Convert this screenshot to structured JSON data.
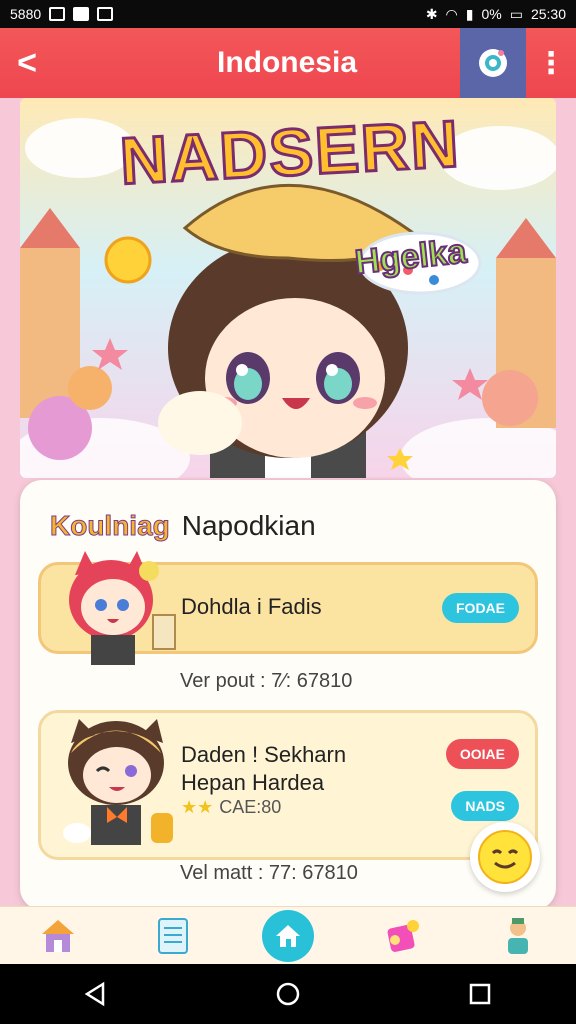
{
  "status_bar": {
    "left_text": "5880",
    "time": "25:30",
    "battery": "0%"
  },
  "app_bar": {
    "title": "Indonesia",
    "back_symbol": "<",
    "more_symbol": "⋮"
  },
  "banner": {
    "title": "NADSERN",
    "subtitle": "Hgelka"
  },
  "panel": {
    "tag": "Koulniag",
    "name": "Napodkian",
    "cards": [
      {
        "title": "Dohdla i Fadis",
        "badge": "FODAE",
        "meta": "Ver pout : 7⁄: 67810"
      },
      {
        "title_line1": "Daden ! Sekharn",
        "title_line2": "Hepan Hardea",
        "stars_text": "CAE:80",
        "badge_top": "OOIAE",
        "badge_bottom": "NADS",
        "meta": "Vel matt : 77: 67810"
      }
    ]
  },
  "colors": {
    "app_bar": "#ee4650",
    "accent_blue": "#29c1d8",
    "accent_red": "#ee5058",
    "card_yellow": "#fbe3a2"
  },
  "icons": [
    "back-icon",
    "camera-icon",
    "more-icon",
    "house-icon",
    "document-icon",
    "home-icon",
    "gift-icon",
    "character-icon",
    "smiley-icon"
  ]
}
